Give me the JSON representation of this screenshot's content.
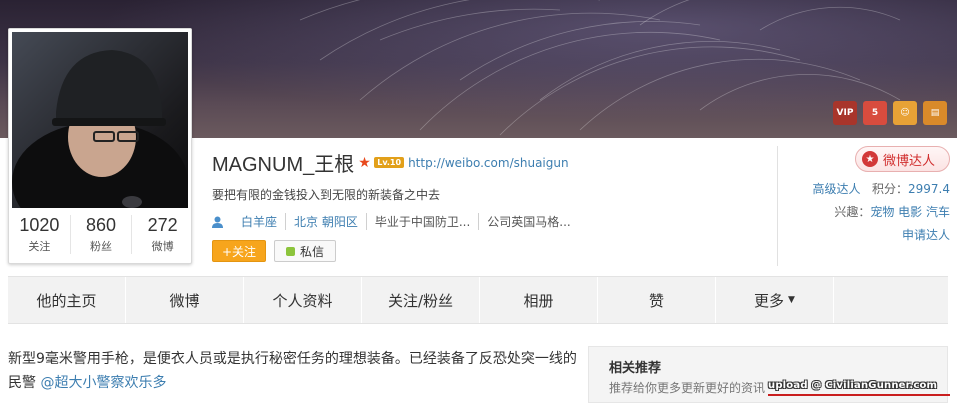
{
  "profile": {
    "name": "MAGNUM_王根",
    "level_badge": "Lv.10",
    "homepage_url": "http://weibo.com/shuaigun",
    "bio": "要把有限的金钱投入到无限的新装备之中去",
    "tags": [
      "白羊座",
      "北京 朝阳区",
      "毕业于中国防卫...",
      "公司英国马格..."
    ],
    "follow_button": "+关注",
    "message_button": "私信"
  },
  "counts": [
    {
      "value": "1020",
      "label": "关注"
    },
    {
      "value": "860",
      "label": "粉丝"
    },
    {
      "value": "272",
      "label": "微博"
    }
  ],
  "badges": {
    "vip": "VIP",
    "five": "5",
    "vip_top": "准"
  },
  "right_panel": {
    "daren_button": "微博达人",
    "level_label": "高级达人",
    "points_label": "积分：",
    "points_value": "2997.4",
    "interests_label": "兴趣：",
    "interests_value": "宠物 电影 汽车",
    "apply_link": "申请达人"
  },
  "nav": {
    "tabs": [
      "他的主页",
      "微博",
      "个人资料",
      "关注/粉丝",
      "相册",
      "赞",
      "更多"
    ]
  },
  "post": {
    "text": "新型9毫米警用手枪，是便衣人员或是执行秘密任务的理想装备。已经装备了反恐处突一线的民警 ",
    "mention": "@超大小警察欢乐多"
  },
  "recommend": {
    "title": "相关推荐",
    "desc": "推荐给你更多更新更好的资讯"
  },
  "watermark": "upload @ CivilianGunner.com",
  "colors": {
    "link": "#3d7eb0",
    "follow": "#f7a51c",
    "daren": "#d12e2e"
  }
}
